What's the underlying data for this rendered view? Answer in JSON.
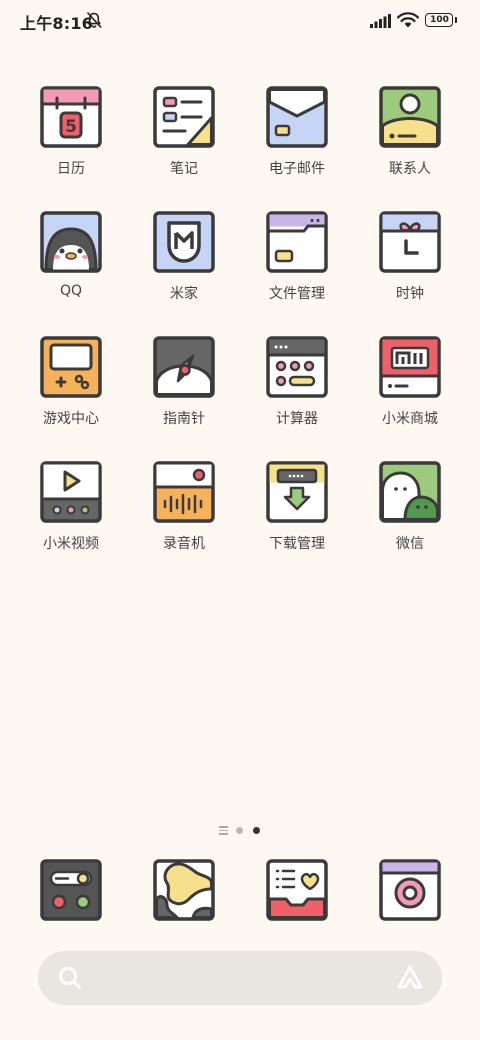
{
  "status_bar": {
    "time": "上午8:16",
    "battery": "100"
  },
  "apps": [
    {
      "id": "calendar",
      "label": "日历",
      "day": "5"
    },
    {
      "id": "notes",
      "label": "笔记"
    },
    {
      "id": "email",
      "label": "电子邮件"
    },
    {
      "id": "contacts",
      "label": "联系人"
    },
    {
      "id": "qq",
      "label": "QQ"
    },
    {
      "id": "mijia",
      "label": "米家"
    },
    {
      "id": "files",
      "label": "文件管理"
    },
    {
      "id": "clock",
      "label": "时钟"
    },
    {
      "id": "games",
      "label": "游戏中心"
    },
    {
      "id": "compass",
      "label": "指南针"
    },
    {
      "id": "calculator",
      "label": "计算器"
    },
    {
      "id": "mistore",
      "label": "小米商城"
    },
    {
      "id": "video",
      "label": "小米视频"
    },
    {
      "id": "recorder",
      "label": "录音机"
    },
    {
      "id": "downloads",
      "label": "下载管理"
    },
    {
      "id": "wechat",
      "label": "微信"
    }
  ],
  "pager": {
    "current_page": 2,
    "page_count": 2
  },
  "dock": [
    {
      "id": "settings-icon"
    },
    {
      "id": "gallery-icon"
    },
    {
      "id": "messages-icon"
    },
    {
      "id": "camera-icon"
    }
  ],
  "colors": {
    "background": "#fdf8f1",
    "outline": "#3a3a3a",
    "pink": "#f49ab6",
    "blue": "#c6d4f6",
    "yellow": "#f6e08c",
    "green": "#9ccb7e",
    "orange": "#f5b25b",
    "red": "#f06068",
    "lilac": "#c9b6e8",
    "search_bg": "#e9e5e0"
  }
}
